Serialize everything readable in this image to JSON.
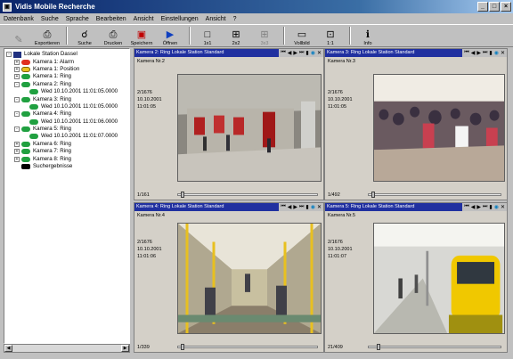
{
  "window": {
    "title": "Vidis Mobile Recherche",
    "buttons": [
      "_",
      "□",
      "×"
    ]
  },
  "menu": [
    "Datenbank",
    "Suche",
    "Sprache",
    "Bearbeiten",
    "Ansicht",
    "Einstellungen",
    "Ansicht",
    "?"
  ],
  "toolbar": [
    {
      "label": "",
      "icon": "pen-icon",
      "glyph": "✎",
      "disabled": true
    },
    {
      "label": "Exportieren",
      "icon": "export-icon",
      "glyph": "⎙",
      "disabled": false
    },
    {
      "label": "Suche",
      "icon": "binoculars-icon",
      "glyph": "☌",
      "disabled": false
    },
    {
      "label": "Drucken",
      "icon": "printer-icon",
      "glyph": "⎙",
      "disabled": false
    },
    {
      "label": "Speichern",
      "icon": "save-icon",
      "glyph": "▣",
      "disabled": false,
      "color": "red"
    },
    {
      "label": "Öffnen",
      "icon": "open-icon",
      "glyph": "▶",
      "disabled": false,
      "color": "blue"
    },
    {
      "label": "1x1",
      "icon": "layout-1x1-icon",
      "glyph": "□",
      "disabled": false
    },
    {
      "label": "2x2",
      "icon": "layout-2x2-icon",
      "glyph": "⊞",
      "disabled": false
    },
    {
      "label": "3x3",
      "icon": "layout-3x3-icon",
      "glyph": "⊞",
      "disabled": true
    },
    {
      "label": "Vollbild",
      "icon": "fullscreen-icon",
      "glyph": "▭",
      "disabled": false
    },
    {
      "label": "1:1",
      "icon": "actual-size-icon",
      "glyph": "⊡",
      "disabled": false
    },
    {
      "label": "Info",
      "icon": "info-icon",
      "glyph": "ℹ",
      "disabled": false
    }
  ],
  "tree": [
    {
      "level": 0,
      "expander": "-",
      "icon": "root",
      "label": "Lokale Station Dassel"
    },
    {
      "level": 1,
      "expander": "+",
      "icon": "red",
      "label": "Kamera 1: Alarm"
    },
    {
      "level": 1,
      "expander": "+",
      "icon": "yellow",
      "label": "Kamera 1: Position"
    },
    {
      "level": 1,
      "expander": "+",
      "icon": "green",
      "label": "Kamera 1: Ring"
    },
    {
      "level": 1,
      "expander": "-",
      "icon": "green",
      "label": "Kamera 2: Ring"
    },
    {
      "level": 2,
      "expander": "",
      "icon": "green",
      "label": "Wed 10.10.2001 11:01:05.0000"
    },
    {
      "level": 1,
      "expander": "-",
      "icon": "green",
      "label": "Kamera 3: Ring"
    },
    {
      "level": 2,
      "expander": "",
      "icon": "green",
      "label": "Wed 10.10.2001 11:01:05.0000"
    },
    {
      "level": 1,
      "expander": "-",
      "icon": "green",
      "label": "Kamera 4: Ring"
    },
    {
      "level": 2,
      "expander": "",
      "icon": "green",
      "label": "Wed 10.10.2001 11:01:06.0000"
    },
    {
      "level": 1,
      "expander": "-",
      "icon": "green",
      "label": "Kamera 5: Ring"
    },
    {
      "level": 2,
      "expander": "",
      "icon": "green",
      "label": "Wed 10.10.2001 11:01:07.0000"
    },
    {
      "level": 1,
      "expander": "+",
      "icon": "green",
      "label": "Kamera 6: Ring"
    },
    {
      "level": 1,
      "expander": "+",
      "icon": "green",
      "label": "Kamera 7: Ring"
    },
    {
      "level": 1,
      "expander": "+",
      "icon": "green",
      "label": "Kamera 8: Ring"
    },
    {
      "level": 1,
      "expander": "",
      "icon": "search",
      "label": "Suchergebnisse"
    }
  ],
  "panes": [
    {
      "header": "Kamera 2: Ring Lokale Station Standard",
      "camera": "Kamera Nr.2",
      "id": "2/1676",
      "date": "10.10.2001",
      "time": "11:01:05",
      "frame": "1/161",
      "slider": 0.02
    },
    {
      "header": "Kamera 3: Ring Lokale Station Standard",
      "camera": "Kamera Nr.3",
      "id": "2/1676",
      "date": "10.10.2001",
      "time": "11:01:05",
      "frame": "1/492",
      "slider": 0.02
    },
    {
      "header": "Kamera 4: Ring Lokale Station Standard",
      "camera": "Kamera Nr.4",
      "id": "2/1676",
      "date": "10.10.2001",
      "time": "11:01:06",
      "frame": "1/339",
      "slider": 0.02
    },
    {
      "header": "Kamera 5: Ring Lokale Station Standard",
      "camera": "Kamera Nr.5",
      "id": "2/1676",
      "date": "10.10.2001",
      "time": "11:01:07",
      "frame": "21/409",
      "slider": 0.06
    }
  ],
  "pane_controls": [
    "⏮",
    "◀",
    "▶",
    "⏭",
    "▮",
    "◉",
    "✕"
  ],
  "colors": {
    "header": "#2030a0",
    "titlebar": "#0a246a"
  }
}
